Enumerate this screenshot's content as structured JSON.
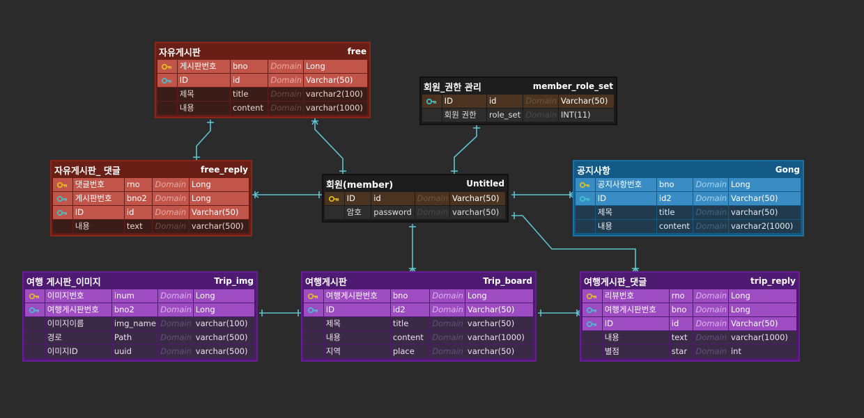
{
  "tables": [
    {
      "id": "free",
      "theme": "red",
      "logical": "자유게시판",
      "physical": "free",
      "cols": [
        {
          "key": "pk",
          "logical": "게시판번호",
          "physical": "bno",
          "domain": "Domain",
          "type": "Long"
        },
        {
          "key": "fk",
          "logical": "ID",
          "physical": "id",
          "domain": "Domain",
          "type": "Varchar(50)"
        },
        {
          "key": "",
          "logical": "제목",
          "physical": "title",
          "domain": "Domain",
          "type": "varchar2(100)"
        },
        {
          "key": "",
          "logical": "내용",
          "physical": "content",
          "domain": "Domain",
          "type": "varchar(1000)"
        }
      ]
    },
    {
      "id": "member_role_set",
      "theme": "dark",
      "logical": "회원_권한 관리",
      "physical": "member_role_set",
      "cols": [
        {
          "key": "fk",
          "logical": "ID",
          "physical": "id",
          "domain": "Domain",
          "type": "Varchar(50)"
        },
        {
          "key": "",
          "logical": "회원 권한",
          "physical": "role_set",
          "domain": "Domain",
          "type": "INT(11)"
        }
      ]
    },
    {
      "id": "free_reply",
      "theme": "red",
      "logical": "자유게시판_ 댓글",
      "physical": "free_reply",
      "cols": [
        {
          "key": "pk",
          "logical": "댓글번호",
          "physical": "rno",
          "domain": "Domain",
          "type": "Long"
        },
        {
          "key": "fk",
          "logical": "게시판번호",
          "physical": "bno2",
          "domain": "Domain",
          "type": "Long"
        },
        {
          "key": "fk",
          "logical": "ID",
          "physical": "id",
          "domain": "Domain",
          "type": "Varchar(50)"
        },
        {
          "key": "",
          "logical": "내용",
          "physical": "text",
          "domain": "Domain",
          "type": "varchar(500)"
        }
      ]
    },
    {
      "id": "member",
      "theme": "dark",
      "logical": "회원(member)",
      "physical": "Untitled",
      "cols": [
        {
          "key": "pk",
          "logical": "ID",
          "physical": "id",
          "domain": "Domain",
          "type": "Varchar(50)"
        },
        {
          "key": "",
          "logical": "암호",
          "physical": "password",
          "domain": "Domain",
          "type": "varchar(50)"
        }
      ]
    },
    {
      "id": "gong",
      "theme": "blue",
      "logical": "공지사항",
      "physical": "Gong",
      "cols": [
        {
          "key": "pk",
          "logical": "공지사항번호",
          "physical": "bno",
          "domain": "Domain",
          "type": "Long"
        },
        {
          "key": "fk",
          "logical": "ID",
          "physical": "id2",
          "domain": "Domain",
          "type": "Varchar(50)"
        },
        {
          "key": "",
          "logical": "제목",
          "physical": "title",
          "domain": "Domain",
          "type": "varchar(50)"
        },
        {
          "key": "",
          "logical": "내용",
          "physical": "content",
          "domain": "Domain",
          "type": "varchar2(1000)"
        }
      ]
    },
    {
      "id": "trip_img",
      "theme": "purple",
      "logical": "여행 게시판_이미지",
      "physical": "Trip_img",
      "cols": [
        {
          "key": "pk",
          "logical": "이미지번호",
          "physical": "inum",
          "domain": "Domain",
          "type": "Long"
        },
        {
          "key": "fk",
          "logical": "여행게시판번호",
          "physical": "bno2",
          "domain": "Domain",
          "type": "Long"
        },
        {
          "key": "",
          "logical": "이미지이름",
          "physical": "img_name",
          "domain": "Domain",
          "type": "varchar(100)"
        },
        {
          "key": "",
          "logical": "경로",
          "physical": "Path",
          "domain": "Domain",
          "type": "varchar(500)"
        },
        {
          "key": "",
          "logical": "이미지ID",
          "physical": "uuid",
          "domain": "Domain",
          "type": "varchar(500)"
        }
      ]
    },
    {
      "id": "trip_board",
      "theme": "purple",
      "logical": "여행게시판",
      "physical": "Trip_board",
      "cols": [
        {
          "key": "pk",
          "logical": "여행게시판번호",
          "physical": "bno",
          "domain": "Domain",
          "type": "Long"
        },
        {
          "key": "fk",
          "logical": "ID",
          "physical": "id2",
          "domain": "Domain",
          "type": "Varchar(50)"
        },
        {
          "key": "",
          "logical": "제목",
          "physical": "title",
          "domain": "Domain",
          "type": "varchar(50)"
        },
        {
          "key": "",
          "logical": "내용",
          "physical": "content",
          "domain": "Domain",
          "type": "varchar(1000)"
        },
        {
          "key": "",
          "logical": "지역",
          "physical": "place",
          "domain": "Domain",
          "type": "varchar(50)"
        }
      ]
    },
    {
      "id": "trip_reply",
      "theme": "purple",
      "logical": "여행게시판_댓글",
      "physical": "trip_reply",
      "cols": [
        {
          "key": "pk",
          "logical": "리뷰번호",
          "physical": "rno",
          "domain": "Domain",
          "type": "Long"
        },
        {
          "key": "fk",
          "logical": "여행게시판번호",
          "physical": "bno",
          "domain": "Domain",
          "type": "Long"
        },
        {
          "key": "fk",
          "logical": "ID",
          "physical": "id",
          "domain": "Domain",
          "type": "Varchar(50)"
        },
        {
          "key": "",
          "logical": "내용",
          "physical": "text",
          "domain": "Domain",
          "type": "varchar(1000)"
        },
        {
          "key": "",
          "logical": "별점",
          "physical": "star",
          "domain": "Domain",
          "type": "int"
        }
      ]
    }
  ],
  "colors": {
    "background": "#2b2b2b",
    "relationship_line": "#5ec4d3",
    "pk_key_icon": "#e8c21b",
    "fk_key_icon": "#3fc8d0"
  },
  "relationships": [
    {
      "from": "free",
      "to": "free_reply"
    },
    {
      "from": "free",
      "to": "member"
    },
    {
      "from": "member_role_set",
      "to": "member"
    },
    {
      "from": "free_reply",
      "to": "member"
    },
    {
      "from": "member",
      "to": "gong"
    },
    {
      "from": "member",
      "to": "trip_board"
    },
    {
      "from": "member",
      "to": "trip_reply"
    },
    {
      "from": "trip_img",
      "to": "trip_board"
    },
    {
      "from": "trip_board",
      "to": "trip_reply"
    }
  ]
}
